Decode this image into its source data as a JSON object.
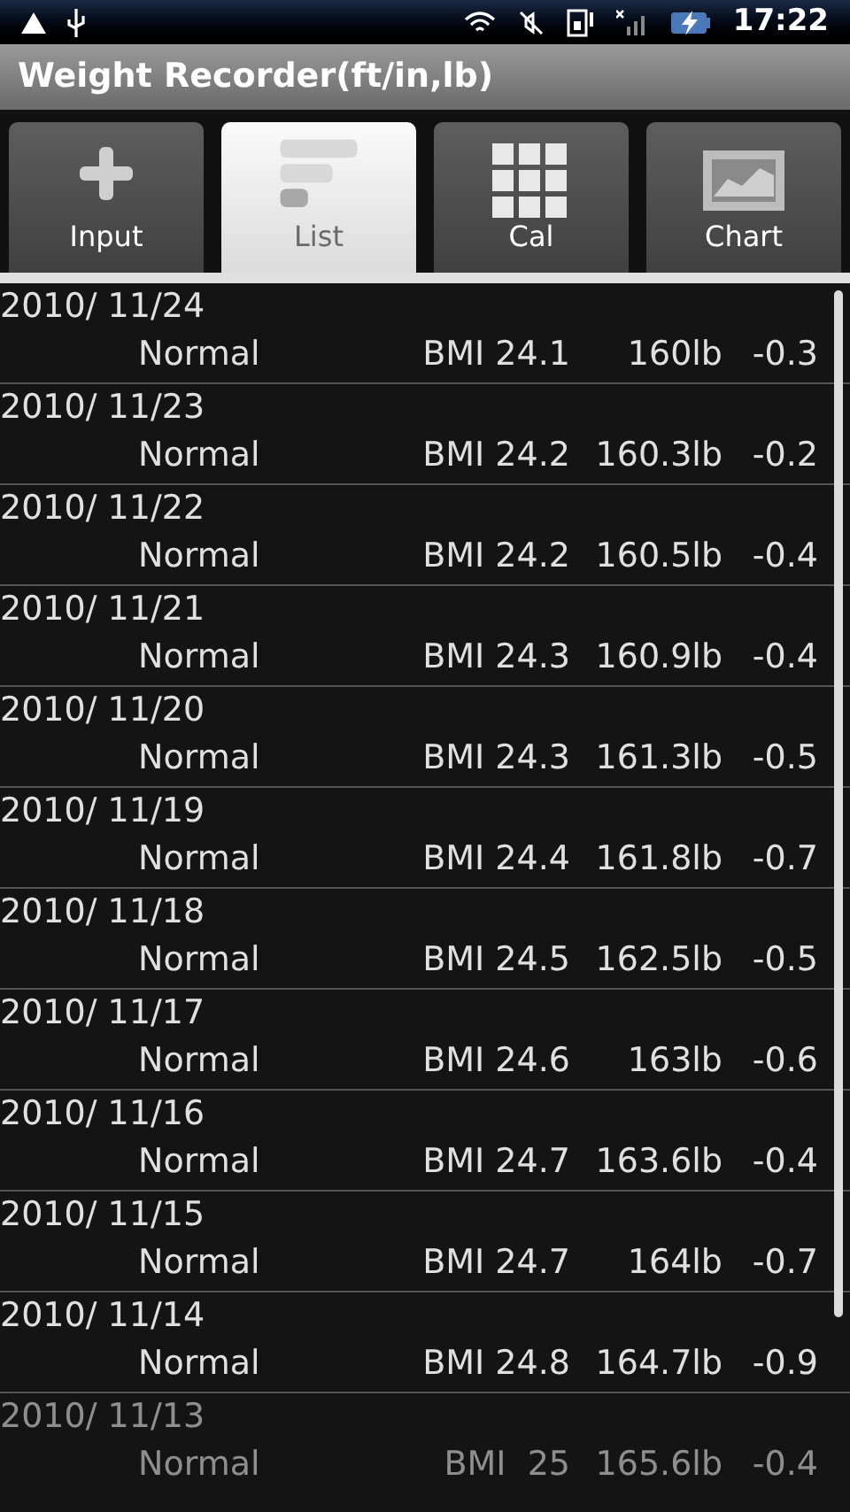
{
  "status_bar": {
    "time": "17:22"
  },
  "window": {
    "title": "Weight Recorder(ft/in,lb)"
  },
  "tabs": [
    {
      "label": "Input",
      "kind": "plus",
      "selected": false
    },
    {
      "label": "List",
      "kind": "list",
      "selected": true
    },
    {
      "label": "Cal",
      "kind": "grid",
      "selected": false
    },
    {
      "label": "Chart",
      "kind": "chart",
      "selected": false
    }
  ],
  "entries": [
    {
      "date": "2010/ 11/24",
      "status": "Normal",
      "bmi": "BMI 24.1",
      "weight": "160lb",
      "change": "-0.3"
    },
    {
      "date": "2010/ 11/23",
      "status": "Normal",
      "bmi": "BMI 24.2",
      "weight": "160.3lb",
      "change": "-0.2"
    },
    {
      "date": "2010/ 11/22",
      "status": "Normal",
      "bmi": "BMI 24.2",
      "weight": "160.5lb",
      "change": "-0.4"
    },
    {
      "date": "2010/ 11/21",
      "status": "Normal",
      "bmi": "BMI 24.3",
      "weight": "160.9lb",
      "change": "-0.4"
    },
    {
      "date": "2010/ 11/20",
      "status": "Normal",
      "bmi": "BMI 24.3",
      "weight": "161.3lb",
      "change": "-0.5"
    },
    {
      "date": "2010/ 11/19",
      "status": "Normal",
      "bmi": "BMI 24.4",
      "weight": "161.8lb",
      "change": "-0.7"
    },
    {
      "date": "2010/ 11/18",
      "status": "Normal",
      "bmi": "BMI 24.5",
      "weight": "162.5lb",
      "change": "-0.5"
    },
    {
      "date": "2010/ 11/17",
      "status": "Normal",
      "bmi": "BMI 24.6",
      "weight": "163lb",
      "change": "-0.6"
    },
    {
      "date": "2010/ 11/16",
      "status": "Normal",
      "bmi": "BMI 24.7",
      "weight": "163.6lb",
      "change": "-0.4"
    },
    {
      "date": "2010/ 11/15",
      "status": "Normal",
      "bmi": "BMI 24.7",
      "weight": "164lb",
      "change": "-0.7"
    },
    {
      "date": "2010/ 11/14",
      "status": "Normal",
      "bmi": "BMI 24.8",
      "weight": "164.7lb",
      "change": "-0.9"
    },
    {
      "date": "2010/ 11/13",
      "status": "Normal",
      "bmi": "BMI  25",
      "weight": "165.6lb",
      "change": "-0.4"
    }
  ]
}
